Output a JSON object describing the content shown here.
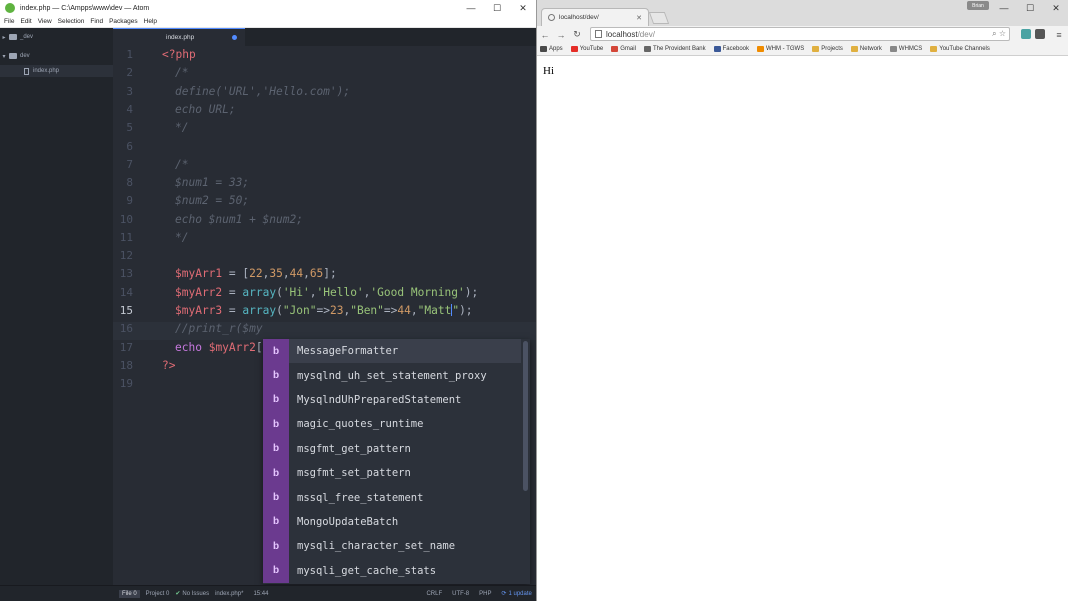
{
  "atom": {
    "title": "index.php — C:\\Ampps\\www\\dev — Atom",
    "window_controls": {
      "minimize": "—",
      "maximize": "☐",
      "close": "✕"
    },
    "menu": [
      "File",
      "Edit",
      "View",
      "Selection",
      "Find",
      "Packages",
      "Help"
    ],
    "tree": [
      {
        "arrow": "▸",
        "label": "_dev"
      },
      {
        "arrow": "▾",
        "label": "dev"
      },
      {
        "label": "index.php"
      }
    ],
    "tab": {
      "label": "index.php"
    },
    "line_numbers": [
      "1",
      "2",
      "3",
      "4",
      "5",
      "6",
      "7",
      "8",
      "9",
      "10",
      "11",
      "12",
      "13",
      "14",
      "15",
      "16",
      "17",
      "18",
      "19"
    ],
    "code": {
      "l1": "<?php",
      "l2": "/*",
      "l3": "define('URL','Hello.com');",
      "l4": "echo URL;",
      "l5": "*/",
      "l7": "/*",
      "l8": "$num1 = 33;",
      "l9": "$num2 = 50;",
      "l10": "echo $num1 + $num2;",
      "l11": "*/",
      "l13": {
        "var": "$myArr1",
        "eq": " = [",
        "n1": "22",
        "n2": "35",
        "n3": "44",
        "n4": "65",
        "end": "];"
      },
      "l14": {
        "var": "$myArr2",
        "eq": " = ",
        "fn": "array",
        "open": "(",
        "s1": "'Hi'",
        "s2": "'Hello'",
        "s3": "'Good Morning'",
        "end": ");"
      },
      "l15": {
        "var": "$myArr3",
        "eq": " = ",
        "fn": "array",
        "open": "(",
        "s1": "\"Jon\"",
        "a1": "=>",
        "n1": "23",
        "s2": "\"Ben\"",
        "a2": "=>",
        "n2": "44",
        "s3a": "\"Matt",
        "s3b": "\"",
        "end": ");"
      },
      "l16": "//print_r($my",
      "l17": {
        "kw": "echo",
        "var": "$myArr2",
        "rest": "["
      },
      "l18": "?>"
    },
    "autocomplete": {
      "badge": "b",
      "items": [
        "MessageFormatter",
        "mysqlnd_uh_set_statement_proxy",
        "MysqlndUhPreparedStatement",
        "magic_quotes_runtime",
        "msgfmt_get_pattern",
        "msgfmt_set_pattern",
        "mssql_free_statement",
        "MongoUpdateBatch",
        "mysqli_character_set_name",
        "mysqli_get_cache_stats"
      ]
    },
    "status": {
      "file": "File 0",
      "project": "Project 0",
      "issues": "No Issues",
      "filename": "index.php*",
      "cursor": "15:44",
      "line_ending": "CRLF",
      "encoding": "UTF-8",
      "grammar": "PHP",
      "updates": "1 update"
    }
  },
  "chrome": {
    "tab_title": "localhost/dev/",
    "user_label": "Brian",
    "url_host": "localhost",
    "url_path": "/dev/",
    "bookmarks": [
      {
        "label": "Apps",
        "color": "#4a4a4a"
      },
      {
        "label": "YouTube",
        "color": "#e52d27"
      },
      {
        "label": "Gmail",
        "color": "#d44638"
      },
      {
        "label": "The Provident Bank",
        "color": "#666666"
      },
      {
        "label": "Facebook",
        "color": "#3b5998"
      },
      {
        "label": "WHM - TGWS",
        "color": "#f08c00"
      },
      {
        "label": "Projects",
        "color": "#e0b040"
      },
      {
        "label": "Network",
        "color": "#e0b040"
      },
      {
        "label": "WHMCS",
        "color": "#888888"
      },
      {
        "label": "YouTube Channels",
        "color": "#e0b040"
      }
    ],
    "page_text": "Hi"
  }
}
